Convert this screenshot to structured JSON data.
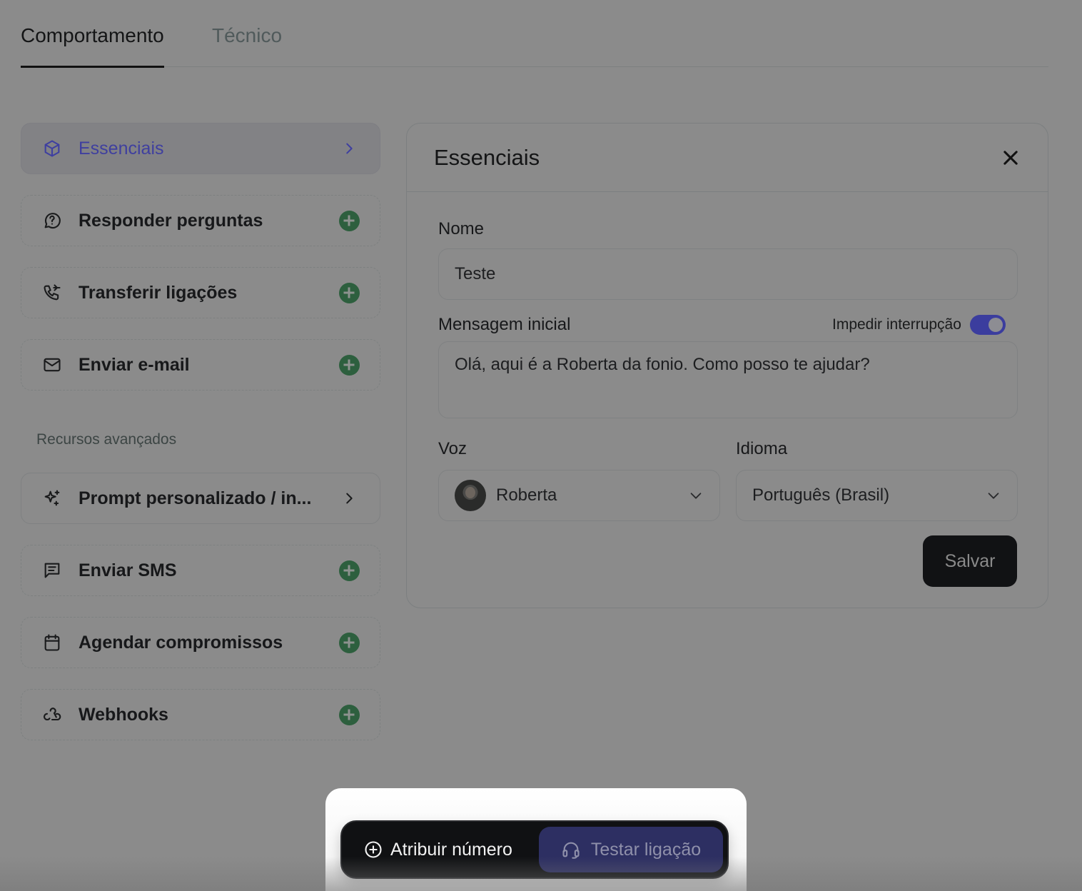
{
  "tabs": [
    {
      "label": "Comportamento",
      "active": true
    },
    {
      "label": "Técnico",
      "active": false
    }
  ],
  "sidebar": {
    "items": [
      {
        "label": "Essenciais",
        "icon": "cube-icon",
        "trail": "chevron",
        "selected": true
      },
      {
        "label": "Responder perguntas",
        "icon": "chat-question-icon",
        "trail": "add"
      },
      {
        "label": "Transferir ligações",
        "icon": "phone-forward-icon",
        "trail": "add"
      },
      {
        "label": "Enviar e-mail",
        "icon": "mail-icon",
        "trail": "add"
      }
    ],
    "section_label": "Recursos avançados",
    "advanced_items": [
      {
        "label": "Prompt personalizado / in...",
        "icon": "sparkles-icon",
        "trail": "chevron"
      },
      {
        "label": "Enviar SMS",
        "icon": "message-icon",
        "trail": "add"
      },
      {
        "label": "Agendar compromissos",
        "icon": "calendar-icon",
        "trail": "add"
      },
      {
        "label": "Webhooks",
        "icon": "webhook-icon",
        "trail": "add"
      }
    ]
  },
  "panel": {
    "title": "Essenciais",
    "name_label": "Nome",
    "name_value": "Teste",
    "message_label": "Mensagem inicial",
    "interrupt_label": "Impedir interrupção",
    "interrupt_on": true,
    "message_value": "Olá, aqui é a Roberta da fonio. Como posso te ajudar?",
    "voice_label": "Voz",
    "voice_value": "Roberta",
    "language_label": "Idioma",
    "language_value": "Português (Brasil)",
    "save_label": "Salvar"
  },
  "action_bar": {
    "assign_label": "Atribuir número",
    "test_label": "Testar ligação"
  },
  "colors": {
    "accent": "#3b3d9e",
    "add_green": "#2d5f3e",
    "overlay_bg": "#8b8b8b"
  }
}
